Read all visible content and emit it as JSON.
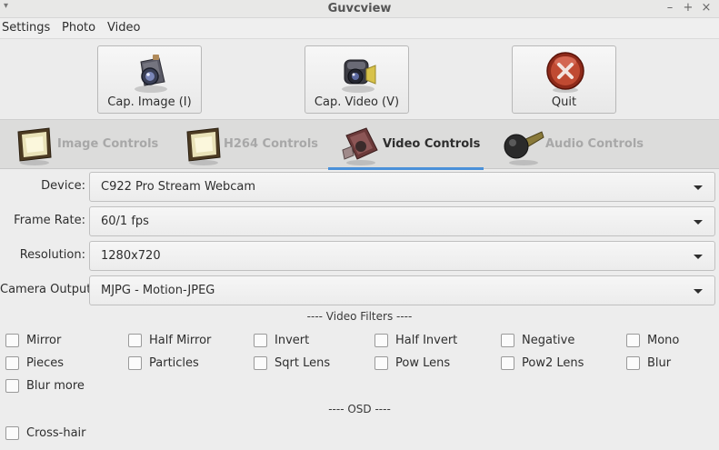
{
  "window": {
    "title": "Guvcview",
    "menu_arrow": "▾",
    "minimize": "–",
    "maximize": "+",
    "close": "×"
  },
  "menubar": {
    "items": [
      "Settings",
      "Photo",
      "Video"
    ]
  },
  "toolbar": {
    "cap_image_label": "Cap. Image (I)",
    "cap_video_label": "Cap. Video (V)",
    "quit_label": "Quit"
  },
  "tabs": [
    {
      "label": "Image Controls",
      "active": false
    },
    {
      "label": "H264 Controls",
      "active": false
    },
    {
      "label": "Video Controls",
      "active": true
    },
    {
      "label": "Audio Controls",
      "active": false
    }
  ],
  "controls": {
    "device": {
      "label": "Device:",
      "value": "C922 Pro Stream Webcam"
    },
    "frame_rate": {
      "label": "Frame Rate:",
      "value": "60/1 fps"
    },
    "resolution": {
      "label": "Resolution:",
      "value": "1280x720"
    },
    "camera_output": {
      "label": "Camera Output:",
      "value": "MJPG - Motion-JPEG"
    }
  },
  "video_filters": {
    "heading": "---- Video Filters ----",
    "items": [
      {
        "label": "Mirror",
        "checked": false
      },
      {
        "label": "Half Mirror",
        "checked": false
      },
      {
        "label": "Invert",
        "checked": false
      },
      {
        "label": "Half Invert",
        "checked": false
      },
      {
        "label": "Negative",
        "checked": false
      },
      {
        "label": "Mono",
        "checked": false
      },
      {
        "label": "Pieces",
        "checked": false
      },
      {
        "label": "Particles",
        "checked": false
      },
      {
        "label": "Sqrt Lens",
        "checked": false
      },
      {
        "label": "Pow Lens",
        "checked": false
      },
      {
        "label": "Pow2 Lens",
        "checked": false
      },
      {
        "label": "Blur",
        "checked": false
      },
      {
        "label": "Blur more",
        "checked": false
      }
    ]
  },
  "osd": {
    "heading": "---- OSD ----",
    "items": [
      {
        "label": "Cross-hair",
        "checked": false
      }
    ]
  },
  "colors": {
    "accent": "#4a90d9",
    "background": "#ececec",
    "tab_inactive_text": "#a8a8a8"
  }
}
